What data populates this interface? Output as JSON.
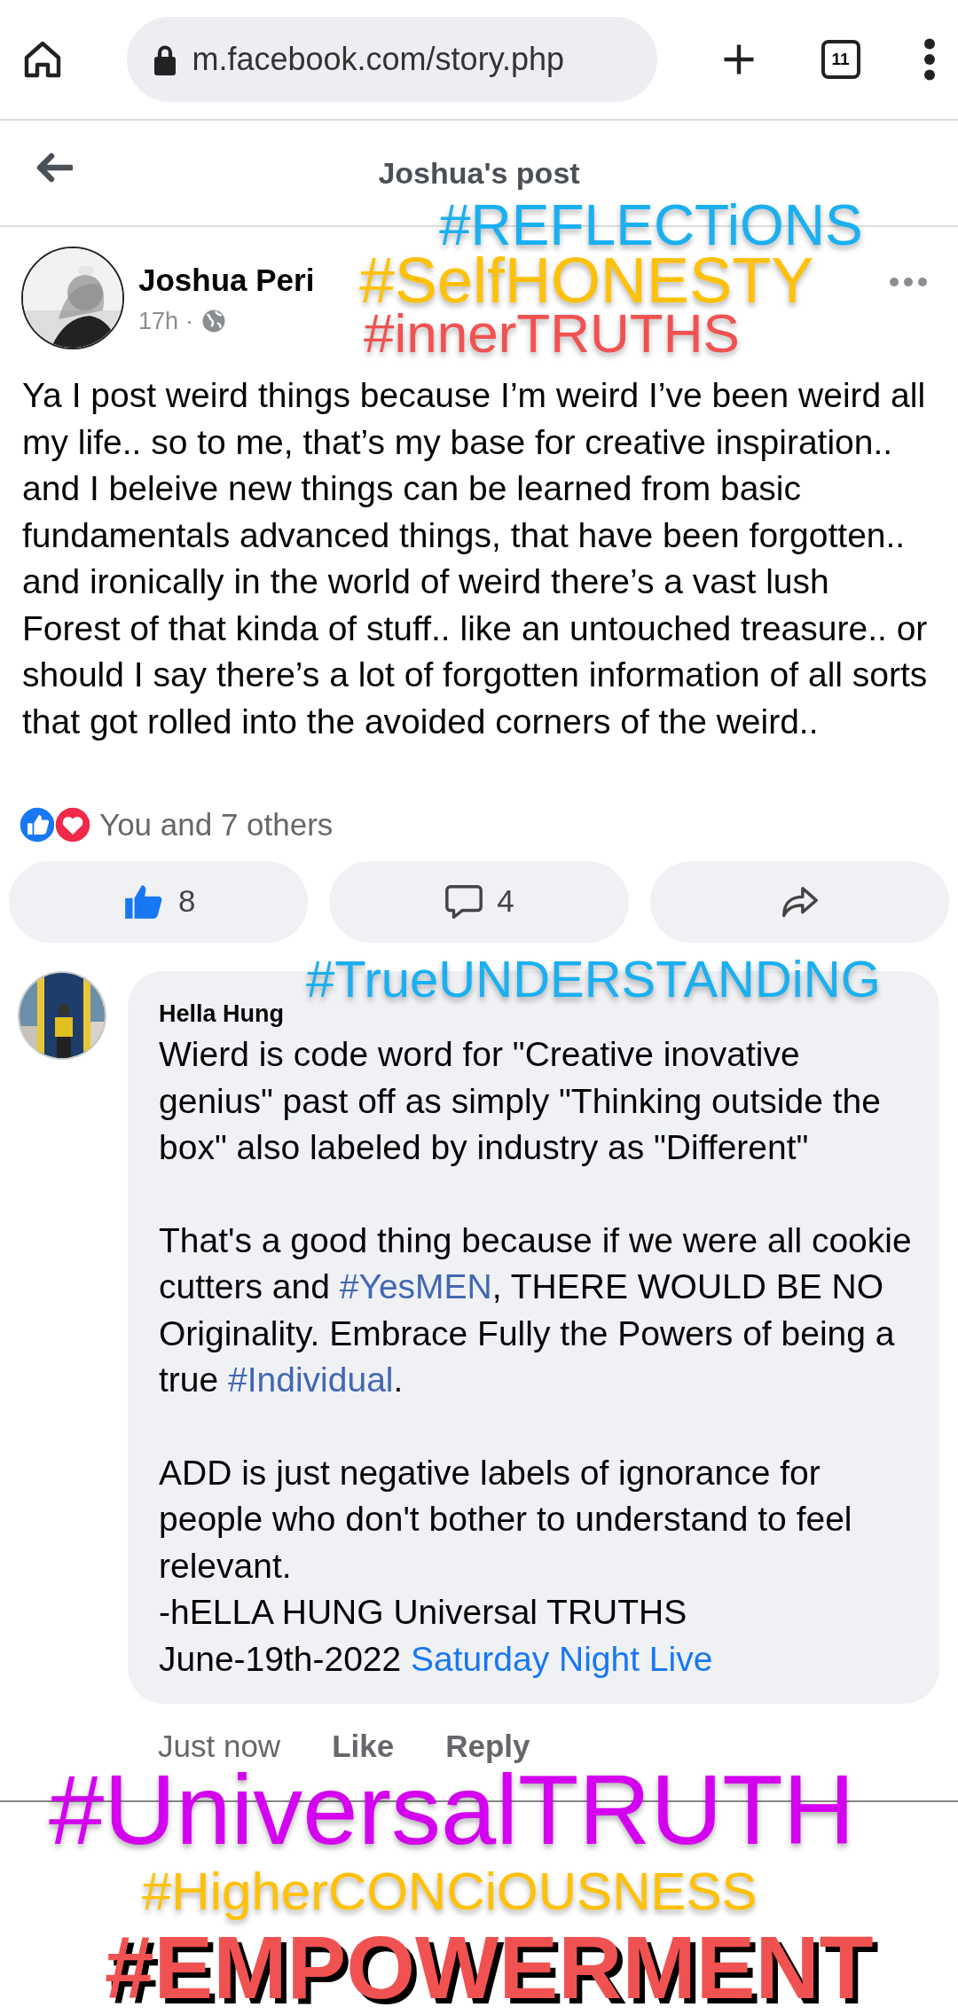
{
  "browser": {
    "url": "m.facebook.com/story.php",
    "tab_count": "11"
  },
  "header": {
    "title": "Joshua's post"
  },
  "post": {
    "author": "Joshua Peri",
    "time": "17h",
    "separator": "·",
    "body": "Ya I post weird things because I’m weird I’ve been weird all my life.. so to me, that’s my base for creative inspiration.. and I beleive new things can be learned from basic fundamentals advanced things, that have been forgotten.. and ironically in the world of weird there’s a vast lush Forest of that kinda of stuff.. like an untouched treasure.. or should I say there’s a lot of forgotten information of all sorts that got rolled into the avoided corners of the weird..",
    "reactions": "You and 7 others",
    "actions": [
      {
        "kind": "like",
        "count": "8"
      },
      {
        "kind": "comment",
        "count": "4"
      },
      {
        "kind": "share"
      }
    ]
  },
  "comment": {
    "author": "Hella Hung",
    "paragraphs": [
      {
        "kind": "para",
        "segments": [
          {
            "kind": "plain",
            "text": "Wierd is code word for \"Creative inovative genius\" past off as simply \"Thinking outside the box\" also labeled by industry as \"Different\""
          }
        ]
      },
      {
        "kind": "para",
        "segments": [
          {
            "kind": "plain",
            "text": "That's a good thing because if we were all cookie cutters and "
          },
          {
            "kind": "hashtag",
            "text": "#YesMEN"
          },
          {
            "kind": "plain",
            "text": ", THERE WOULD BE NO Originality. Embrace Fully the Powers of being a true "
          },
          {
            "kind": "hashtag",
            "text": "#Individual"
          },
          {
            "kind": "plain",
            "text": "."
          }
        ]
      },
      {
        "kind": "para",
        "segments": [
          {
            "kind": "plain",
            "text": "ADD is just negative labels of ignorance for people who don't bother to understand to feel relevant."
          }
        ]
      },
      {
        "kind": "line",
        "segments": [
          {
            "kind": "plain",
            "text": "-hELLA HUNG Universal TRUTHS"
          }
        ]
      },
      {
        "kind": "line",
        "segments": [
          {
            "kind": "plain",
            "text": "June-19th-2022 "
          },
          {
            "kind": "link",
            "text": "Saturday Night Live"
          }
        ]
      }
    ],
    "time": "Just now",
    "like": "Like",
    "reply": "Reply"
  },
  "overlay_tags": [
    {
      "text": "#REFLECTiONS",
      "color": "#1ab0f0"
    },
    {
      "text": "#SelfHONESTY",
      "color": "#ffc107"
    },
    {
      "text": "#innerTRUTHS",
      "color": "#f05252"
    },
    {
      "text": "#TrueUNDERSTANDiNG",
      "color": "#1ab0f0"
    },
    {
      "text": "#UniversalTRUTH",
      "color": "#d400f0"
    },
    {
      "text": "#HigherCONCiOUSNESS",
      "color": "#ffc107"
    },
    {
      "text": "#EMPOWERMENT",
      "color": "#f05252"
    }
  ]
}
